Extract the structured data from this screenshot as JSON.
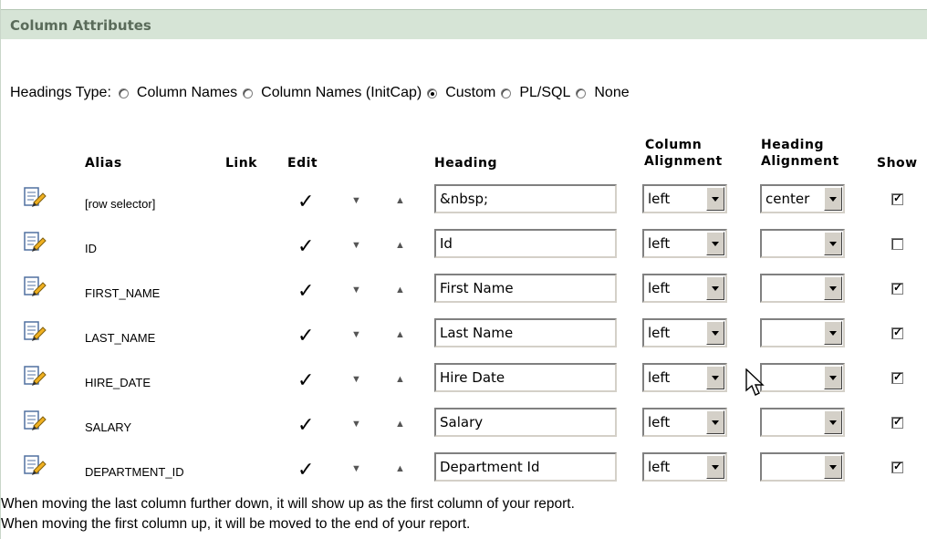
{
  "section": {
    "title": "Column Attributes"
  },
  "headings_type": {
    "label": "Headings Type:",
    "options": [
      {
        "label": "Column Names",
        "selected": false
      },
      {
        "label": "Column Names (InitCap)",
        "selected": false
      },
      {
        "label": "Custom",
        "selected": true
      },
      {
        "label": "PL/SQL",
        "selected": false
      },
      {
        "label": "None",
        "selected": false
      }
    ]
  },
  "table": {
    "headers": {
      "alias": "Alias",
      "link": "Link",
      "edit": "Edit",
      "heading": "Heading",
      "col_align_1": "Column",
      "col_align_2": "Alignment",
      "head_align_1": "Heading",
      "head_align_2": "Alignment",
      "show": "Show"
    },
    "rows": [
      {
        "alias": "[row selector]",
        "heading": "&nbsp;",
        "column_alignment": "left",
        "heading_alignment": "center",
        "show": true
      },
      {
        "alias": "ID",
        "heading": "Id",
        "column_alignment": "left",
        "heading_alignment": "",
        "show": false
      },
      {
        "alias": "FIRST_NAME",
        "heading": "First Name",
        "column_alignment": "left",
        "heading_alignment": "",
        "show": true
      },
      {
        "alias": "LAST_NAME",
        "heading": "Last Name",
        "column_alignment": "left",
        "heading_alignment": "",
        "show": true
      },
      {
        "alias": "HIRE_DATE",
        "heading": "Hire Date",
        "column_alignment": "left",
        "heading_alignment": "",
        "show": true
      },
      {
        "alias": "SALARY",
        "heading": "Salary",
        "column_alignment": "left",
        "heading_alignment": "",
        "show": true
      },
      {
        "alias": "DEPARTMENT_ID",
        "heading": "Department Id",
        "column_alignment": "left",
        "heading_alignment": "",
        "show": true
      }
    ]
  },
  "notes": [
    "When moving the last column further down, it will show up as the first column of your report.",
    "When moving the first column up, it will be moved to the end of your report."
  ],
  "icons": {
    "edit": "edit-column-icon",
    "check": "checkmark-icon",
    "move_down": "move-down-icon",
    "move_up": "move-up-icon"
  }
}
